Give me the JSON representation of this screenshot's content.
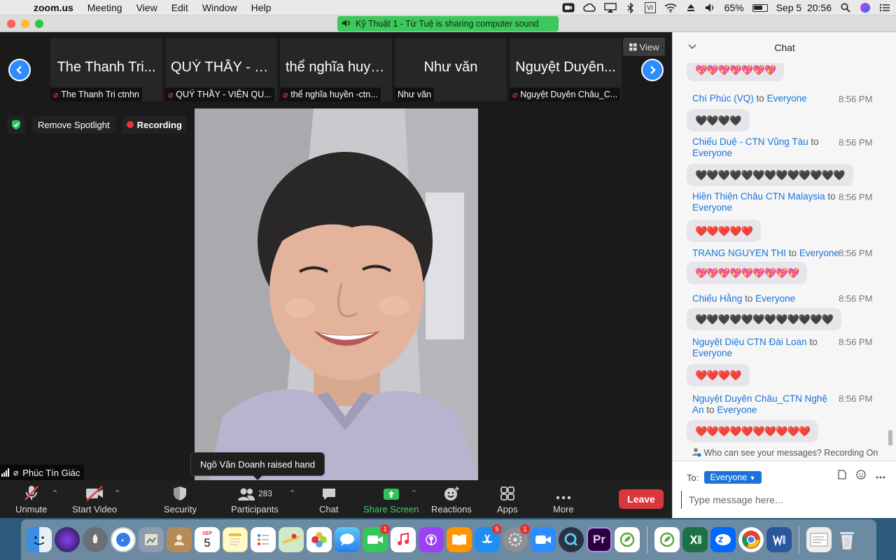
{
  "menubar": {
    "app": "zoom.us",
    "menus": [
      "Meeting",
      "View",
      "Edit",
      "Window",
      "Help"
    ],
    "battery": "65%",
    "datetime": "Sep 5  20:56"
  },
  "window": {
    "share_banner": "Kỹ Thuật 1  - Từ Tuệ is sharing computer sound"
  },
  "filmstrip": {
    "tiles": [
      {
        "name": "The Thanh Tri...",
        "label": "The Thanh Tri ctnhn"
      },
      {
        "name": "QUÝ THẦY - V...",
        "label": "QUÝ THẦY - VIÊN QU..."
      },
      {
        "name": "thể nghĩa huyề...",
        "label": "thể nghĩa huyền -ctn..."
      },
      {
        "name": "Như văn",
        "label": "Như văn"
      },
      {
        "name": "Nguyệt Duyên...",
        "label": "Nguyệt Duyên Châu_C..."
      }
    ],
    "view_label": "View"
  },
  "spotlight": {
    "remove_label": "Remove Spotlight",
    "recording_label": "Recording"
  },
  "speaker": {
    "name": "Phúc Tín Giác"
  },
  "toast": {
    "text": "Ngô Văn Doanh raised hand"
  },
  "toolbar": {
    "unmute": "Unmute",
    "start_video": "Start Video",
    "security": "Security",
    "participants": "Participants",
    "participants_count": "283",
    "chat": "Chat",
    "share_screen": "Share Screen",
    "reactions": "Reactions",
    "apps": "Apps",
    "more": "More",
    "leave": "Leave"
  },
  "chat": {
    "title": "Chat",
    "messages": [
      {
        "from": "",
        "to": "",
        "time": "",
        "content": "💖💖💖💖💖💖💖"
      },
      {
        "from": "Chí Phúc (VQ)",
        "to": "Everyone",
        "time": "8:56 PM",
        "content": "🖤🖤🖤🖤"
      },
      {
        "from": "Chiếu Duệ - CTN Vũng Tàu",
        "to": "Everyone",
        "time": "8:56 PM",
        "content": "🖤🖤🖤🖤🖤🖤🖤🖤🖤🖤🖤🖤🖤"
      },
      {
        "from": "Hiền Thiện Châu CTN Malaysia",
        "to": "Everyone",
        "time": "8:56 PM",
        "content": "❤️❤️❤️❤️❤️"
      },
      {
        "from": "TRANG NGUYEN THI",
        "to": "Everyone",
        "time": "8:56 PM",
        "content": "💖💖💖💖💖💖💖💖💖"
      },
      {
        "from": "Chiếu Hằng",
        "to": "Everyone",
        "time": "8:56 PM",
        "content": "🖤🖤🖤🖤🖤🖤🖤🖤🖤🖤🖤🖤"
      },
      {
        "from": "Nguyệt Diệu CTN Đài Loan",
        "to": "Everyone",
        "time": "8:56 PM",
        "content": "❤️❤️❤️❤️"
      },
      {
        "from": "Nguyệt Duyên Châu_CTN Nghệ An",
        "to": "Everyone",
        "time": "8:56 PM",
        "content": "❤️❤️❤️❤️❤️❤️❤️❤️❤️❤️"
      }
    ],
    "to_word": "to",
    "who_can_see": "Who can see your messages? Recording On",
    "to_label": "To:",
    "recipient": "Everyone",
    "input_placeholder": "Type message here..."
  },
  "dock": {
    "calendar_month": "SEP",
    "calendar_day": "5",
    "badges": {
      "facetime": "1",
      "appstore": "5",
      "sysprefs": "1"
    }
  }
}
